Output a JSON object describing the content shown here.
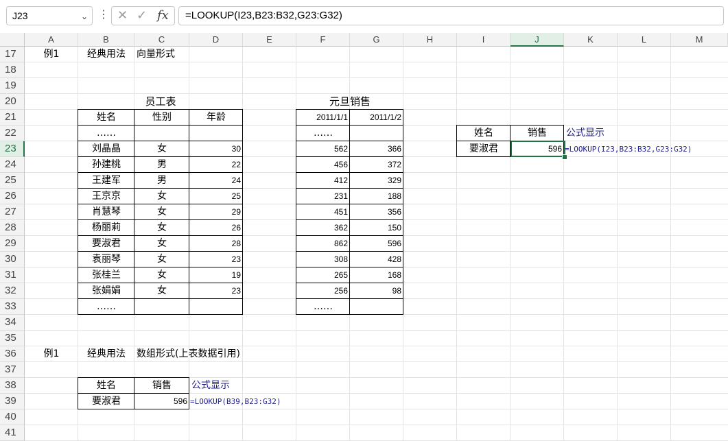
{
  "namebox": {
    "value": "J23"
  },
  "formula_bar": {
    "fx_label": "fx",
    "value": "=LOOKUP(I23,B23:B32,G23:G32)"
  },
  "columns": [
    "A",
    "B",
    "C",
    "D",
    "E",
    "F",
    "G",
    "H",
    "I",
    "J",
    "K",
    "L",
    "M"
  ],
  "rows": [
    "17",
    "18",
    "19",
    "20",
    "21",
    "22",
    "23",
    "24",
    "25",
    "26",
    "27",
    "28",
    "29",
    "30",
    "31",
    "32",
    "33",
    "34",
    "35",
    "36",
    "37",
    "38",
    "39",
    "40",
    "41"
  ],
  "section1": {
    "example": "例1",
    "usage": "经典用法",
    "form": "向量形式"
  },
  "employee_table": {
    "title": "员工表",
    "headers": [
      "姓名",
      "性别",
      "年龄"
    ],
    "ellipsis": "……",
    "rows": [
      [
        "刘晶晶",
        "女",
        "30"
      ],
      [
        "孙建桃",
        "男",
        "22"
      ],
      [
        "王建军",
        "男",
        "24"
      ],
      [
        "王京京",
        "女",
        "25"
      ],
      [
        "肖慧琴",
        "女",
        "29"
      ],
      [
        "杨丽莉",
        "女",
        "26"
      ],
      [
        "要淑君",
        "女",
        "28"
      ],
      [
        "袁丽琴",
        "女",
        "23"
      ],
      [
        "张桂兰",
        "女",
        "19"
      ],
      [
        "张娟娟",
        "女",
        "23"
      ]
    ]
  },
  "sales_table": {
    "title": "元旦销售",
    "headers": [
      "2011/1/1",
      "2011/1/2"
    ],
    "ellipsis": "……",
    "rows": [
      [
        "562",
        "366"
      ],
      [
        "456",
        "372"
      ],
      [
        "412",
        "329"
      ],
      [
        "231",
        "188"
      ],
      [
        "451",
        "356"
      ],
      [
        "362",
        "150"
      ],
      [
        "862",
        "596"
      ],
      [
        "308",
        "428"
      ],
      [
        "265",
        "168"
      ],
      [
        "256",
        "98"
      ]
    ]
  },
  "lookup1": {
    "h_name": "姓名",
    "h_sales": "销售",
    "name": "要淑君",
    "sales": "596",
    "formula_label": "公式显示",
    "formula": "=LOOKUP(I23,B23:B32,G23:G32)"
  },
  "section2": {
    "example": "例1",
    "usage": "经典用法",
    "form": "数组形式(上表数据引用)"
  },
  "lookup2": {
    "h_name": "姓名",
    "h_sales": "销售",
    "name": "要淑君",
    "sales": "596",
    "formula_label": "公式显示",
    "formula": "=LOOKUP(B39,B23:G32)"
  },
  "colors": {
    "accent": "#217346",
    "formula_text": "#1f1f8f"
  }
}
